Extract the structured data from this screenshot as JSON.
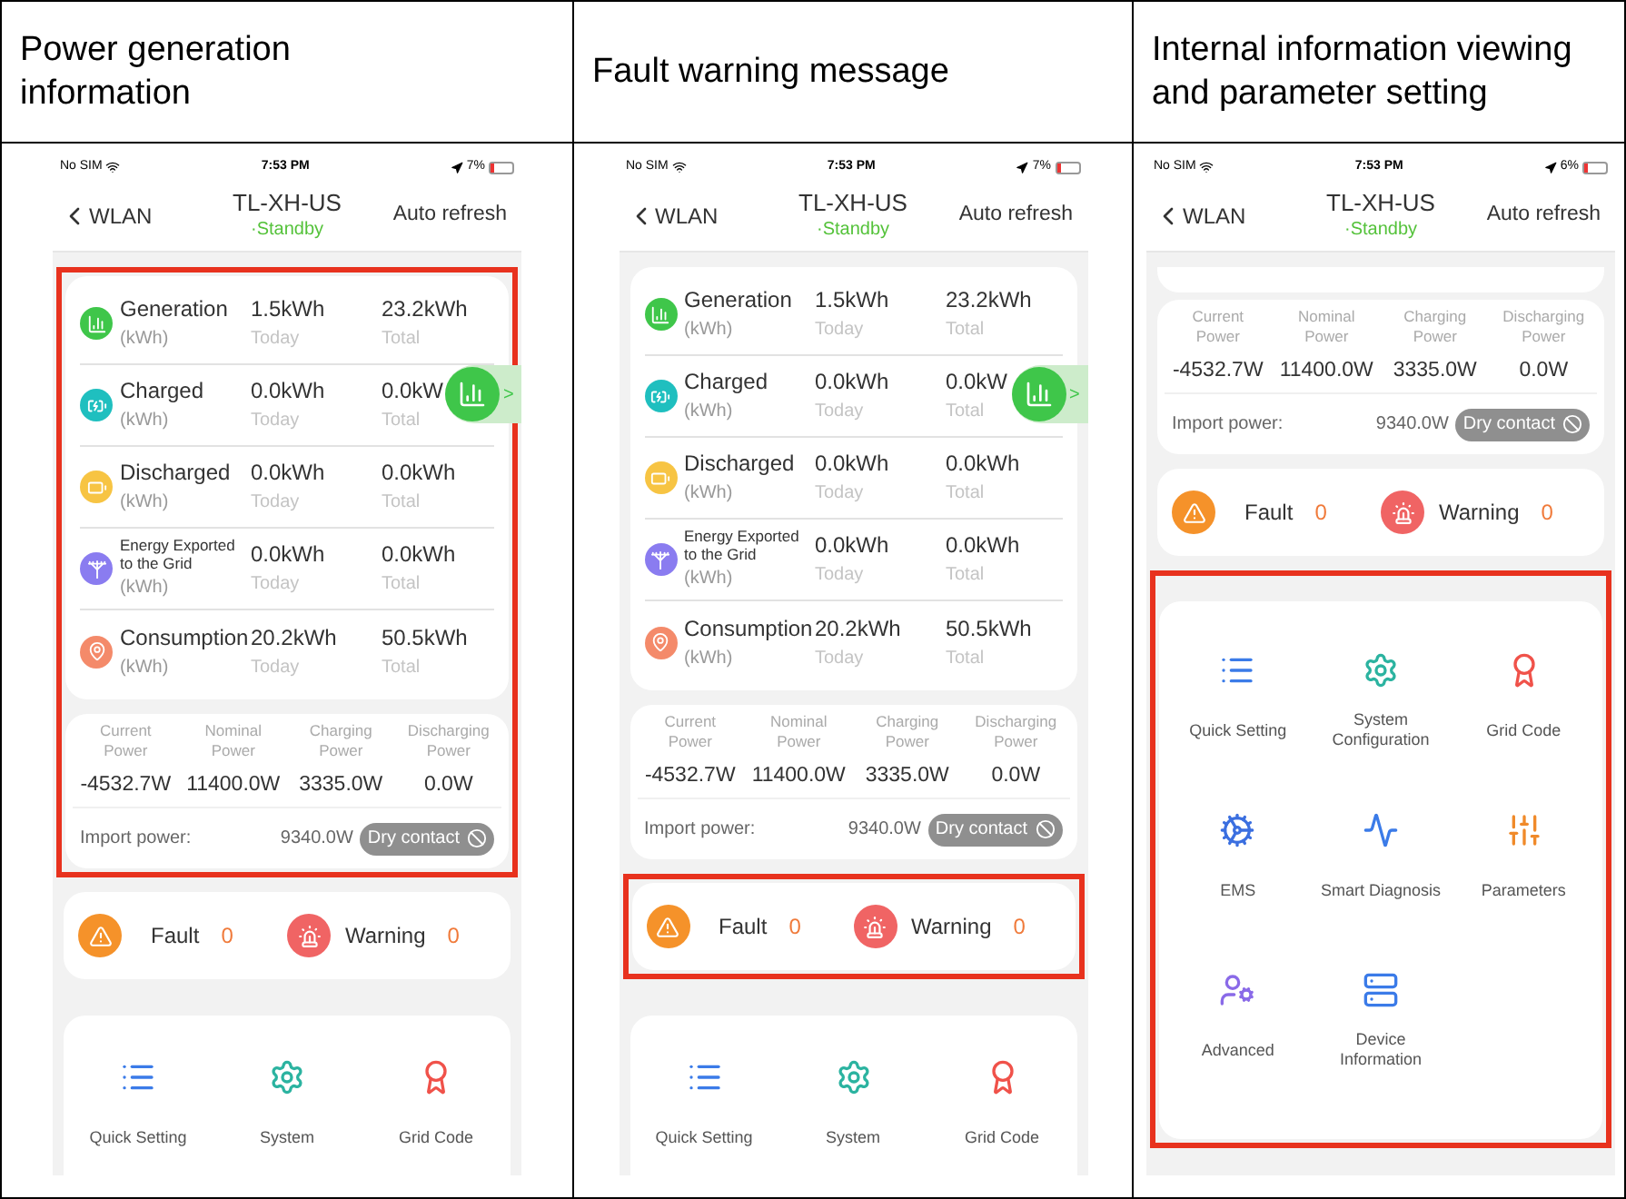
{
  "columns": [
    {
      "title": "Power generation information",
      "phone": {
        "status": {
          "carrier": "No SIM",
          "time": "7:53 PM",
          "battery": "7%"
        },
        "nav": {
          "back": "WLAN",
          "title": "TL-XH-US",
          "subtitle": "·Standby",
          "action": "Auto refresh"
        },
        "floating_tab": {
          "arrow": ">"
        },
        "sections": [
          {
            "kind": "energy",
            "highlighted": true,
            "rows": [
              {
                "kind": "generation",
                "label": "Generation",
                "unit": "(kWh)",
                "today": "1.5kWh",
                "today_label": "Today",
                "total": "23.2kWh",
                "total_label": "Total"
              },
              {
                "kind": "charged",
                "label": "Charged",
                "unit": "(kWh)",
                "today": "0.0kWh",
                "today_label": "Today",
                "total": "0.0kW",
                "total_label": "Total"
              },
              {
                "kind": "discharged",
                "label": "Discharged",
                "unit": "(kWh)",
                "today": "0.0kWh",
                "today_label": "Today",
                "total": "0.0kWh",
                "total_label": "Total"
              },
              {
                "kind": "exported",
                "label": "Energy Exported to the Grid",
                "unit": "(kWh)",
                "today": "0.0kWh",
                "today_label": "Today",
                "total": "0.0kWh",
                "total_label": "Total"
              },
              {
                "kind": "consumption",
                "label": "Consumption",
                "unit": "(kWh)",
                "today": "20.2kWh",
                "today_label": "Today",
                "total": "50.5kWh",
                "total_label": "Total"
              }
            ]
          },
          {
            "kind": "power",
            "highlighted": true,
            "metrics": [
              {
                "label": "Current Power",
                "value": "-4532.7W"
              },
              {
                "label": "Nominal Power",
                "value": "11400.0W"
              },
              {
                "label": "Charging Power",
                "value": "3335.0W"
              },
              {
                "label": "Discharging Power",
                "value": "0.0W"
              }
            ],
            "import_label": "Import power:",
            "import_value": "9340.0W",
            "dry_contact": {
              "label": "Dry contact",
              "disabled": true
            }
          },
          {
            "kind": "alerts",
            "highlighted": false,
            "items": [
              {
                "kind": "fault",
                "label": "Fault",
                "count": "0"
              },
              {
                "kind": "warning",
                "label": "Warning",
                "count": "0"
              }
            ]
          },
          {
            "kind": "menu",
            "highlighted": false,
            "items": [
              {
                "kind": "quick",
                "label": "Quick Setting"
              },
              {
                "kind": "system",
                "label": "System"
              },
              {
                "kind": "grid",
                "label": "Grid Code"
              }
            ]
          }
        ]
      }
    },
    {
      "title": "Fault warning message",
      "phone": {
        "status": {
          "carrier": "No SIM",
          "time": "7:53 PM",
          "battery": "7%"
        },
        "nav": {
          "back": "WLAN",
          "title": "TL-XH-US",
          "subtitle": "·Standby",
          "action": "Auto refresh"
        },
        "floating_tab": {
          "arrow": ">"
        },
        "sections": [
          {
            "kind": "energy",
            "highlighted": false,
            "rows": [
              {
                "kind": "generation",
                "label": "Generation",
                "unit": "(kWh)",
                "today": "1.5kWh",
                "today_label": "Today",
                "total": "23.2kWh",
                "total_label": "Total"
              },
              {
                "kind": "charged",
                "label": "Charged",
                "unit": "(kWh)",
                "today": "0.0kWh",
                "today_label": "Today",
                "total": "0.0kW",
                "total_label": "Total"
              },
              {
                "kind": "discharged",
                "label": "Discharged",
                "unit": "(kWh)",
                "today": "0.0kWh",
                "today_label": "Today",
                "total": "0.0kWh",
                "total_label": "Total"
              },
              {
                "kind": "exported",
                "label": "Energy Exported to the Grid",
                "unit": "(kWh)",
                "today": "0.0kWh",
                "today_label": "Today",
                "total": "0.0kWh",
                "total_label": "Total"
              },
              {
                "kind": "consumption",
                "label": "Consumption",
                "unit": "(kWh)",
                "today": "20.2kWh",
                "today_label": "Today",
                "total": "50.5kWh",
                "total_label": "Total"
              }
            ]
          },
          {
            "kind": "power",
            "highlighted": false,
            "metrics": [
              {
                "label": "Current Power",
                "value": "-4532.7W"
              },
              {
                "label": "Nominal Power",
                "value": "11400.0W"
              },
              {
                "label": "Charging Power",
                "value": "3335.0W"
              },
              {
                "label": "Discharging Power",
                "value": "0.0W"
              }
            ],
            "import_label": "Import power:",
            "import_value": "9340.0W",
            "dry_contact": {
              "label": "Dry contact",
              "disabled": true
            }
          },
          {
            "kind": "alerts",
            "highlighted": true,
            "items": [
              {
                "kind": "fault",
                "label": "Fault",
                "count": "0"
              },
              {
                "kind": "warning",
                "label": "Warning",
                "count": "0"
              }
            ]
          },
          {
            "kind": "menu",
            "highlighted": false,
            "items": [
              {
                "kind": "quick",
                "label": "Quick Setting"
              },
              {
                "kind": "system",
                "label": "System"
              },
              {
                "kind": "grid",
                "label": "Grid Code"
              }
            ]
          }
        ]
      }
    },
    {
      "title": "Internal information viewing and parameter setting",
      "phone": {
        "status": {
          "carrier": "No SIM",
          "time": "7:53 PM",
          "battery": "6%"
        },
        "nav": {
          "back": "WLAN",
          "title": "TL-XH-US",
          "subtitle": "·Standby",
          "action": "Auto refresh"
        },
        "sections": [
          {
            "kind": "card_edge"
          },
          {
            "kind": "power",
            "highlighted": false,
            "metrics": [
              {
                "label": "Current Power",
                "value": "-4532.7W"
              },
              {
                "label": "Nominal Power",
                "value": "11400.0W"
              },
              {
                "label": "Charging Power",
                "value": "3335.0W"
              },
              {
                "label": "Discharging Power",
                "value": "0.0W"
              }
            ],
            "import_label": "Import power:",
            "import_value": "9340.0W",
            "dry_contact": {
              "label": "Dry contact",
              "disabled": true
            }
          },
          {
            "kind": "alerts",
            "highlighted": false,
            "items": [
              {
                "kind": "fault",
                "label": "Fault",
                "count": "0"
              },
              {
                "kind": "warning",
                "label": "Warning",
                "count": "0"
              }
            ]
          },
          {
            "kind": "menu",
            "highlighted": true,
            "items": [
              {
                "kind": "quick",
                "label": "Quick Setting"
              },
              {
                "kind": "system",
                "label": "System Configuration"
              },
              {
                "kind": "grid",
                "label": "Grid Code"
              },
              {
                "kind": "ems",
                "label": "EMS"
              },
              {
                "kind": "diagnosis",
                "label": "Smart Diagnosis"
              },
              {
                "kind": "parameters",
                "label": "Parameters"
              },
              {
                "kind": "advanced",
                "label": "Advanced"
              },
              {
                "kind": "device",
                "label": "Device Information"
              }
            ]
          }
        ]
      }
    }
  ]
}
